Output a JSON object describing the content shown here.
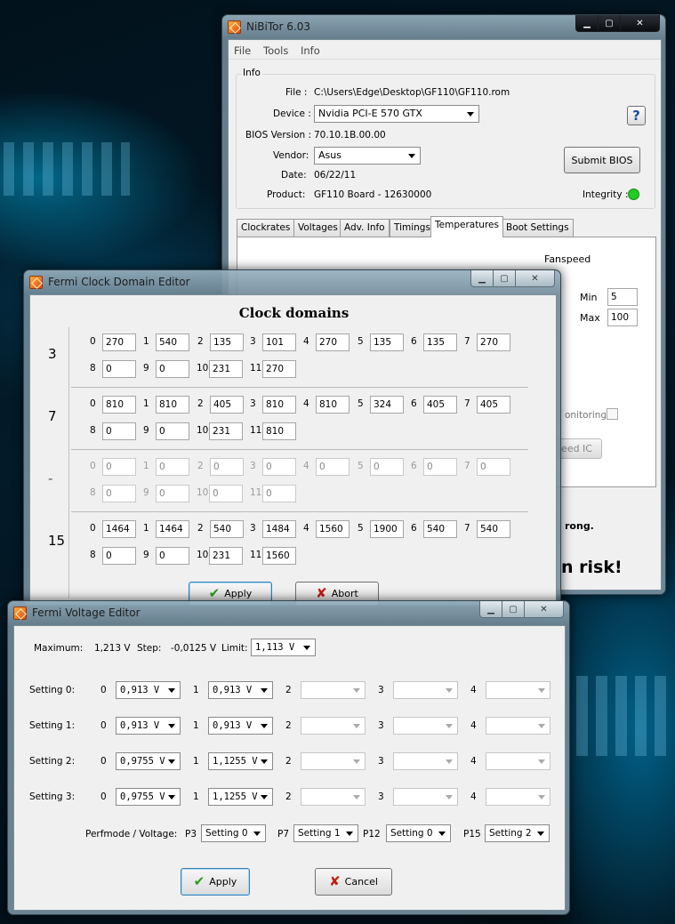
{
  "nibitor": {
    "title": "NiBiTor 6.03",
    "menu": [
      "File",
      "Tools",
      "Info"
    ],
    "info_group": "Info",
    "file_label": "File :",
    "file_value": "C:\\Users\\Edge\\Desktop\\GF110\\GF110.rom",
    "device_label": "Device :",
    "device_value": "Nvidia PCI-E 570 GTX",
    "bios_label": "BIOS Version :",
    "bios_value": "70.10.1B.00.00",
    "vendor_label": "Vendor:",
    "vendor_value": "Asus",
    "date_label": "Date:",
    "date_value": "06/22/11",
    "product_label": "Product:",
    "product_value": "GF110 Board - 12630000",
    "help_glyph": "?",
    "submit_bios": "Submit BIOS",
    "integrity_label": "Integrity :",
    "integrity_color": "#22cc22",
    "tabs": [
      "Clockrates",
      "Voltages",
      "Adv. Info",
      "Timings",
      "Temperatures",
      "Boot Settings"
    ],
    "active_tab": "Temperatures",
    "fanspeed_label": "Fanspeed",
    "min_label": "Min",
    "min_value": "5",
    "max_label": "Max",
    "max_value": "100",
    "monitoring_label": "onitoring:",
    "speed_ic_label": "eed IC",
    "warning_text": "rong.",
    "risk_text": "n risk!"
  },
  "clock": {
    "title": "Fermi Clock Domain Editor",
    "heading": "Clock domains",
    "groups": [
      {
        "label": "3",
        "enabled": true,
        "values": [
          "270",
          "540",
          "135",
          "101",
          "270",
          "135",
          "135",
          "270",
          "0",
          "0",
          "231",
          "270"
        ]
      },
      {
        "label": "7",
        "enabled": true,
        "values": [
          "810",
          "810",
          "405",
          "810",
          "810",
          "324",
          "405",
          "405",
          "0",
          "0",
          "231",
          "810"
        ]
      },
      {
        "label": "-",
        "enabled": false,
        "values": [
          "0",
          "0",
          "0",
          "0",
          "0",
          "0",
          "0",
          "0",
          "0",
          "0",
          "0",
          "0"
        ]
      },
      {
        "label": "15",
        "enabled": true,
        "values": [
          "1464",
          "1464",
          "540",
          "1484",
          "1560",
          "1900",
          "540",
          "540",
          "0",
          "0",
          "231",
          "1560"
        ]
      }
    ],
    "indices": [
      "0",
      "1",
      "2",
      "3",
      "4",
      "5",
      "6",
      "7",
      "8",
      "9",
      "10",
      "11"
    ],
    "apply": "Apply",
    "abort": "Abort"
  },
  "voltage": {
    "title": "Fermi Voltage Editor",
    "maximum_label": "Maximum:",
    "maximum_value": "1,213 V",
    "step_label": "Step:",
    "step_value": "-0,0125 V",
    "limit_label": "Limit:",
    "limit_value": "1,113 V",
    "settings": [
      {
        "label": "Setting 0:",
        "values": [
          "0,913 V",
          "0,913 V",
          "",
          "",
          ""
        ]
      },
      {
        "label": "Setting 1:",
        "values": [
          "0,913 V",
          "0,913 V",
          "",
          "",
          ""
        ]
      },
      {
        "label": "Setting 2:",
        "values": [
          "0,9755 V",
          "1,1255 V",
          "",
          "",
          ""
        ]
      },
      {
        "label": "Setting 3:",
        "values": [
          "0,9755 V",
          "1,1255 V",
          "",
          "",
          ""
        ]
      }
    ],
    "col_indices": [
      "0",
      "1",
      "2",
      "3",
      "4"
    ],
    "perf_label": "Perfmode / Voltage:",
    "perf": [
      {
        "label": "P3",
        "value": "Setting 0"
      },
      {
        "label": "P7",
        "value": "Setting 1"
      },
      {
        "label": "P12",
        "value": "Setting 0"
      },
      {
        "label": "P15",
        "value": "Setting 2"
      }
    ],
    "apply": "Apply",
    "cancel": "Cancel"
  }
}
